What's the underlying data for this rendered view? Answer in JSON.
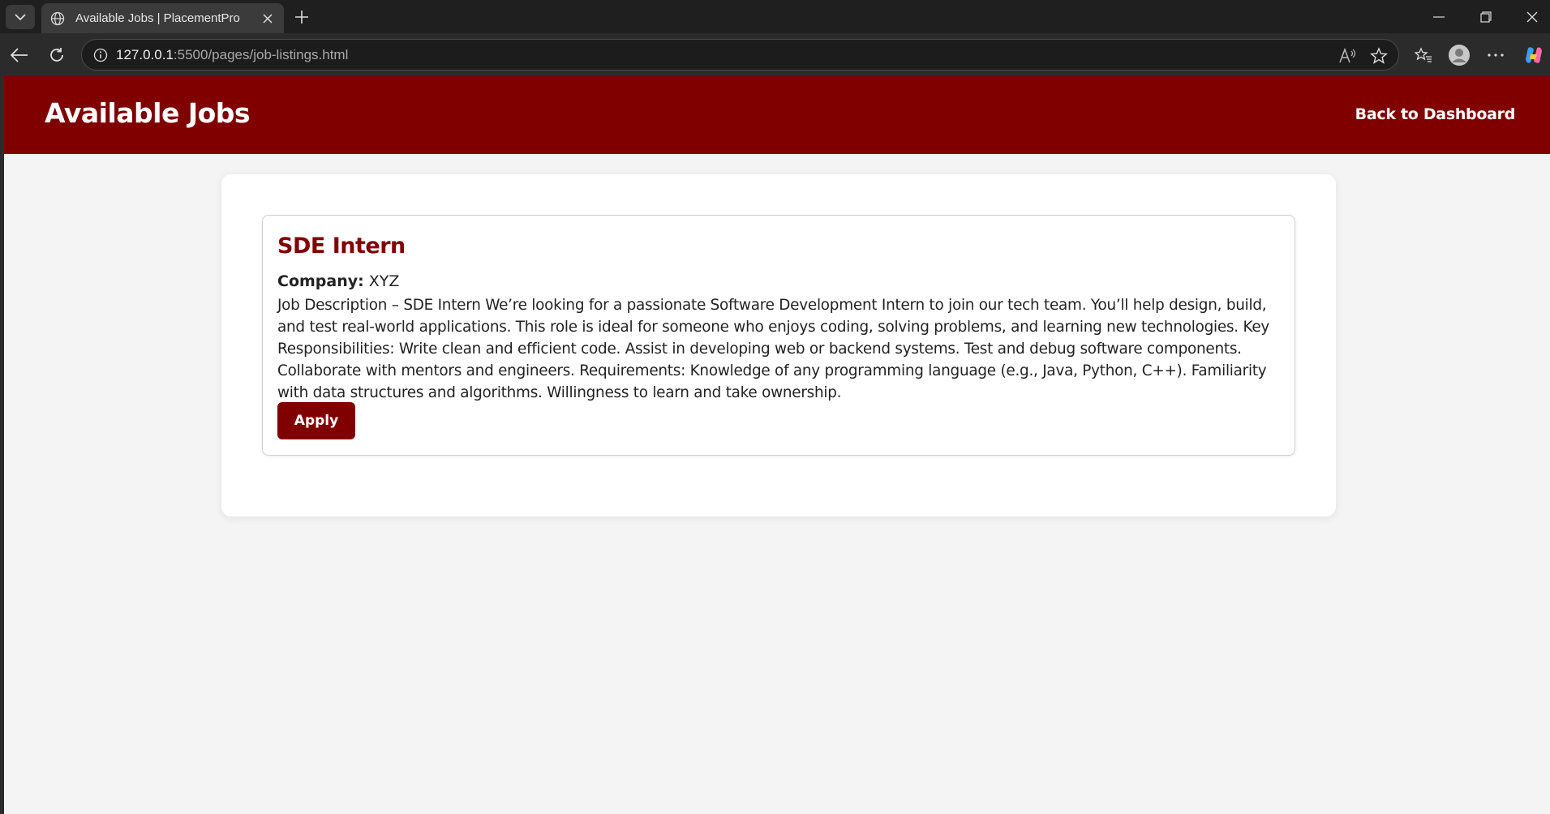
{
  "browser": {
    "tab_title": "Available Jobs | PlacementPro",
    "url_host": "127.0.0.1",
    "url_path": ":5500/pages/job-listings.html"
  },
  "header": {
    "title": "Available Jobs",
    "back_link": "Back to Dashboard"
  },
  "jobs": [
    {
      "title": "SDE Intern",
      "company_label": "Company:",
      "company": "XYZ",
      "description": "Job Description – SDE Intern We’re looking for a passionate Software Development Intern to join our tech team. You’ll help design, build, and test real-world applications. This role is ideal for someone who enjoys coding, solving problems, and learning new technologies. Key Responsibilities: Write clean and efficient code. Assist in developing web or backend systems. Test and debug software components. Collaborate with mentors and engineers. Requirements: Knowledge of any programming language (e.g., Java, Python, C++). Familiarity with data structures and algorithms. Willingness to learn and take ownership.",
      "apply_label": "Apply"
    }
  ],
  "colors": {
    "brand": "#800000",
    "page_bg": "#f4f4f4"
  }
}
